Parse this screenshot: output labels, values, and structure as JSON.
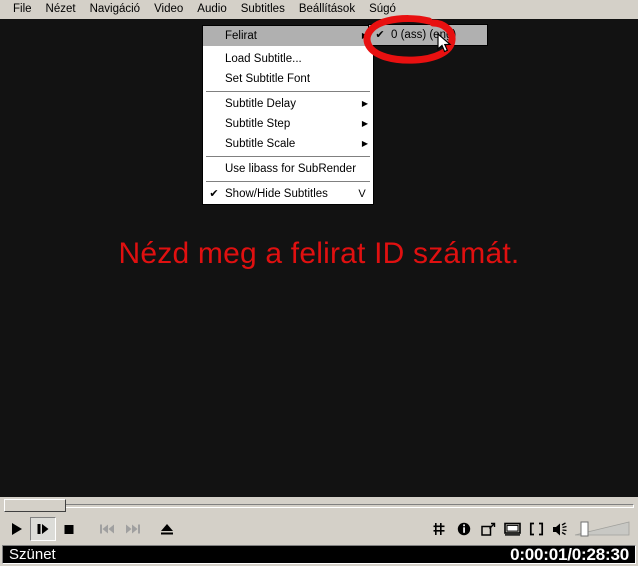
{
  "menubar": {
    "items": [
      {
        "label": "File",
        "name": "menu-file"
      },
      {
        "label": "Nézet",
        "name": "menu-nezet"
      },
      {
        "label": "Navigáció",
        "name": "menu-navigacio"
      },
      {
        "label": "Video",
        "name": "menu-video"
      },
      {
        "label": "Audio",
        "name": "menu-audio"
      },
      {
        "label": "Subtitles",
        "name": "menu-subtitles"
      },
      {
        "label": "Beállítások",
        "name": "menu-beallitasok"
      },
      {
        "label": "Súgó",
        "name": "menu-sugo"
      }
    ]
  },
  "subtitles_menu": {
    "items": [
      {
        "label": "Felirat",
        "check": "",
        "arrow": "▶",
        "accel": "",
        "highlighted": true
      },
      {
        "label": "Load Subtitle...",
        "check": "",
        "arrow": "",
        "accel": ""
      },
      {
        "label": "Set Subtitle Font",
        "check": "",
        "arrow": "",
        "accel": ""
      },
      {
        "label": "Subtitle Delay",
        "check": "",
        "arrow": "▶",
        "accel": ""
      },
      {
        "label": "Subtitle Step",
        "check": "",
        "arrow": "▶",
        "accel": ""
      },
      {
        "label": "Subtitle Scale",
        "check": "",
        "arrow": "▶",
        "accel": ""
      },
      {
        "label": "Use libass for SubRender",
        "check": "",
        "arrow": "",
        "accel": ""
      },
      {
        "label": "Show/Hide Subtitles",
        "check": "✔",
        "arrow": "",
        "accel": "V"
      }
    ]
  },
  "felirat_submenu": {
    "items": [
      {
        "label": "0 (ass) (eng)",
        "check": "✔",
        "highlighted": true
      }
    ]
  },
  "video": {
    "subtitle_text": "Nézd meg a felirat ID számát.",
    "subtitle_color": "#e01010",
    "background_color": "#121212"
  },
  "annotation": {
    "shape": "red-circle",
    "color": "#e81010"
  },
  "cursor": {
    "type": "arrow-pointer"
  },
  "seekbar": {
    "position_percent": 0
  },
  "controls": {
    "buttons": [
      {
        "name": "play-button",
        "icon": "play-icon",
        "state": "enabled"
      },
      {
        "name": "pause-button",
        "icon": "pause-icon",
        "state": "pressed"
      },
      {
        "name": "stop-button",
        "icon": "stop-icon",
        "state": "enabled"
      },
      {
        "name": "previous-button",
        "icon": "skip-backward-icon",
        "state": "disabled"
      },
      {
        "name": "next-button",
        "icon": "skip-forward-icon",
        "state": "disabled"
      },
      {
        "name": "eject-button",
        "icon": "eject-icon",
        "state": "enabled"
      }
    ],
    "right_buttons": [
      {
        "name": "playlist-button",
        "icon": "playlist-icon"
      },
      {
        "name": "info-button",
        "icon": "info-icon"
      },
      {
        "name": "resize-button",
        "icon": "resize-icon"
      },
      {
        "name": "fullscreen-button",
        "icon": "fullscreen-icon"
      },
      {
        "name": "aspect-ratio-button",
        "icon": "brackets-icon"
      },
      {
        "name": "mute-button",
        "icon": "speaker-muted-icon"
      }
    ],
    "volume": {
      "name": "volume-slider",
      "level_percent": 8
    }
  },
  "statusbar": {
    "state_label": "Szünet",
    "time_display": "0:00:01/0:28:30"
  }
}
